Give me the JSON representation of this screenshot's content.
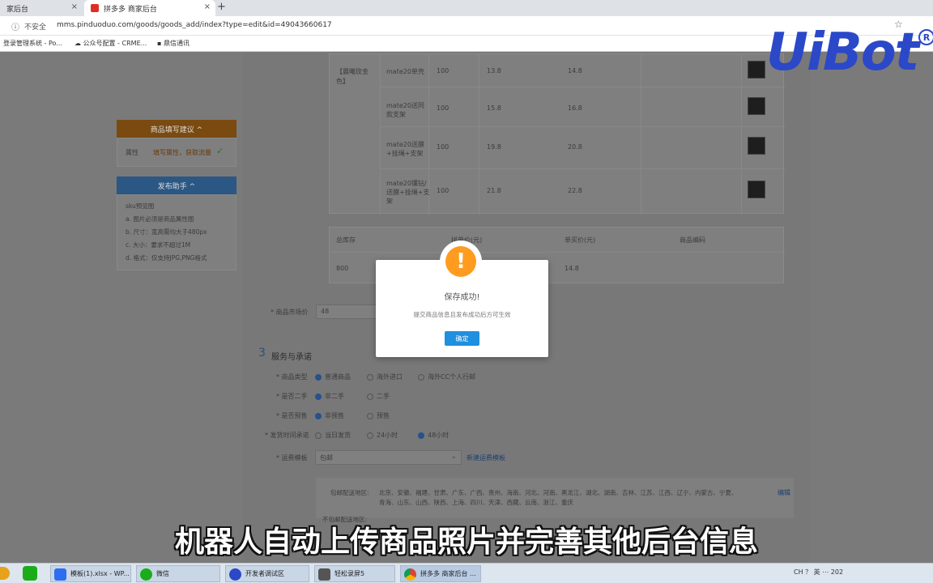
{
  "browser": {
    "tabs": [
      {
        "label": "家后台"
      },
      {
        "label": "拼多多 商家后台"
      }
    ],
    "new_tab": "+",
    "close": "×",
    "security": "不安全",
    "url": "mms.pinduoduo.com/goods/goods_add/index?type=edit&id=49043660617",
    "bookmarks": [
      "登录管理系统 - Po...",
      "公众号配置 - CRME...",
      "鼎信通讯"
    ]
  },
  "sidebar": {
    "suggest_title": "商品填写建议 ^",
    "suggest_label": "属性",
    "suggest_value": "填写属性，获取流量",
    "helper_title": "发布助手 ^",
    "helper_lines": [
      "sku预览图",
      "a. 图片必须是商品属性图",
      "b. 尺寸：宽高需均大于480px",
      "c. 大小：要求不超过1M",
      "d. 格式：仅支持JPG,PNG格式"
    ]
  },
  "sku_table": {
    "color": "【晨曦玫金色】",
    "rows": [
      {
        "name": "mate20单壳",
        "stock": "100",
        "group_price": "13.8",
        "single_price": "14.8"
      },
      {
        "name": "mate20送同款支架",
        "stock": "100",
        "group_price": "15.8",
        "single_price": "16.8"
      },
      {
        "name": "mate20送膜+挂绳+支架",
        "stock": "100",
        "group_price": "19.8",
        "single_price": "20.8"
      },
      {
        "name": "mate20镶钻/送膜+挂绳+支架",
        "stock": "100",
        "group_price": "21.8",
        "single_price": "22.8"
      }
    ]
  },
  "summary": {
    "headers": [
      "总库存",
      "拼单价(元)",
      "单买价(元)",
      "商品编码"
    ],
    "values": [
      "800",
      "",
      "14.8",
      ""
    ]
  },
  "market_price": {
    "label": "* 商品市场价",
    "value": "48"
  },
  "service": {
    "number": "3",
    "title": "服务与承诺",
    "type_label": "* 商品类型",
    "type_options": [
      "普通商品",
      "海外进口",
      "海外CC个人行邮"
    ],
    "second_label": "* 是否二手",
    "second_options": [
      "非二手",
      "二手"
    ],
    "presale_label": "* 是否预售",
    "presale_options": [
      "非预售",
      "预售"
    ],
    "ship_label": "* 发货时间承诺",
    "ship_options": [
      "当日发货",
      "24小时",
      "48小时"
    ],
    "template_label": "* 运费模板",
    "template_value": "包邮",
    "new_template": "新建运费模板",
    "region_label": "包邮配送地区:",
    "region_line1": "北京、安徽、福建、甘肃、广东、广西、贵州、海南、河北、河南、黑龙江、湖北、湖南、吉林、江苏、江西、辽宁、内蒙古、宁夏、",
    "region_line2": "青海、山东、山西、陕西、上海、四川、天津、西藏、云南、浙江、重庆",
    "edit": "编辑",
    "nonship_label": "不包邮配送地区:"
  },
  "dialog": {
    "icon": "!",
    "title": "保存成功!",
    "message": "提交商品信息且发布成功后方可生效",
    "confirm": "确定"
  },
  "logo": {
    "text": "UiBot",
    "mark": "R"
  },
  "subtitle": "机器人自动上传商品照片并完善其他后台信息",
  "taskbar": {
    "items": [
      "模板(1).xlsx - WP...",
      "微信",
      "开发者调试区",
      "轻松录屏5",
      "拼多多 商家后台 ..."
    ],
    "tray": "CH ？ 英 ⋯ 202"
  },
  "colors": {
    "dialog_button": "#1f8fe0",
    "warning": "#ff9b1f",
    "logo": "#2b48c9"
  }
}
